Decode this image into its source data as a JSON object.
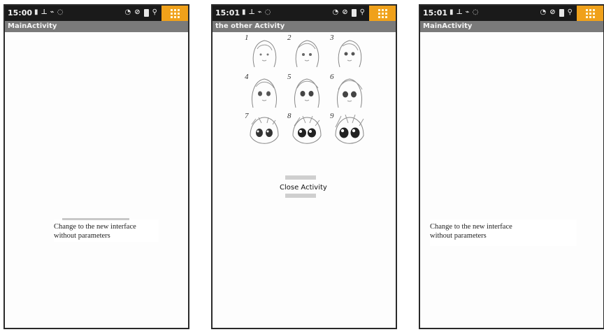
{
  "screens": [
    {
      "status_time": "15:00",
      "title": "MainActivity",
      "button_line1": "Change to the new interface",
      "button_line2": "without parameters"
    },
    {
      "status_time": "15:01",
      "title": "the other Activity",
      "image_numbers": [
        "1",
        "2",
        "3",
        "4",
        "5",
        "6",
        "7",
        "8",
        "9"
      ],
      "close_label": "Close Activity"
    },
    {
      "status_time": "15:01",
      "title": "MainActivity",
      "button_line1": "Change to the new interface",
      "button_line2": "without parameters"
    }
  ],
  "icons": {
    "status_left": [
      "sim-icon",
      "signal-icon",
      "usb-icon",
      "wifi-icon"
    ],
    "status_right": [
      "wifi-icon",
      "sync-icon",
      "battery-icon",
      "usb-icon"
    ],
    "menu": "menu-grid-icon"
  },
  "colors": {
    "status_bar": "#1a1a1a",
    "title_bar": "#7a7a7a",
    "menu_tile": "#f0a11a"
  }
}
